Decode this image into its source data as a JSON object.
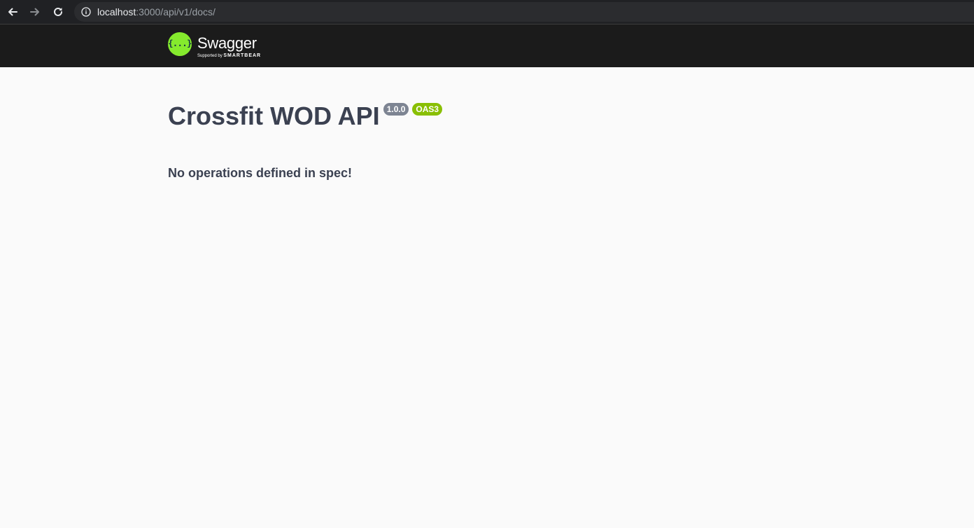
{
  "browser": {
    "url_host": "localhost",
    "url_path": ":3000/api/v1/docs/",
    "icons": {
      "back": "arrow-left-icon",
      "forward": "arrow-right-icon",
      "reload": "reload-icon",
      "site_info": "info-icon"
    }
  },
  "topbar": {
    "logo_mark": "{...}",
    "logo_word": "Swagger",
    "logo_supported_by": "Supported by",
    "logo_brand": "SMARTBEAR"
  },
  "info": {
    "title": "Crossfit WOD API",
    "version": "1.0.0",
    "oas": "OAS3"
  },
  "main": {
    "no_operations": "No operations defined in spec!"
  },
  "colors": {
    "background": "#fafafa",
    "topbar": "#1b1b1b",
    "swagger_green": "#85ea2d",
    "oas_badge": "#89bf04",
    "version_badge": "#7d8492",
    "text": "#3b4151"
  }
}
